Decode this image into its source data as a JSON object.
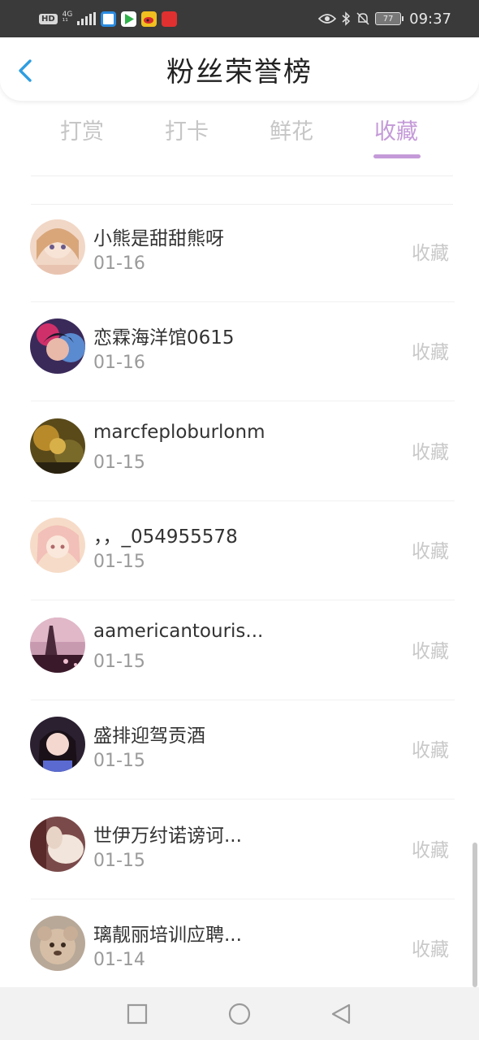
{
  "status_bar": {
    "left_badge": "HD",
    "network": "4G",
    "network_sub": "¹¹",
    "time": "09:37",
    "battery": "77",
    "icons": [
      "signal-icon",
      "app-blue-icon",
      "app-play-icon",
      "app-weibo-icon",
      "app-red-icon",
      "eye-icon",
      "bluetooth-icon",
      "mute-bell-icon",
      "battery-icon"
    ]
  },
  "header": {
    "title": "粉丝荣誉榜",
    "back_icon": "chevron-left-icon"
  },
  "tabs": [
    {
      "label": "打赏",
      "active": false
    },
    {
      "label": "打卡",
      "active": false
    },
    {
      "label": "鲜花",
      "active": false
    },
    {
      "label": "收藏",
      "active": true
    }
  ],
  "colors": {
    "accent": "#c49ad8",
    "inactive_tab": "#c6c6c6",
    "status_bar_bg": "#3a3a3a"
  },
  "list": [
    {
      "name": "小熊是甜甜熊呀",
      "date": "01-16",
      "action": "收藏"
    },
    {
      "name": "恋霖海洋馆0615",
      "date": "01-16",
      "action": "收藏"
    },
    {
      "name": "marcfeploburlonm",
      "date": "01-15",
      "action": "收藏"
    },
    {
      "name": "，，_054955578",
      "date": "01-15",
      "action": "收藏"
    },
    {
      "name": "aamericantouris...",
      "date": "01-15",
      "action": "收藏"
    },
    {
      "name": "盛排迎驾贡酒",
      "date": "01-15",
      "action": "收藏"
    },
    {
      "name": "世伊万纣诺谤诃...",
      "date": "01-15",
      "action": "收藏"
    },
    {
      "name": "璃靓丽培训应聘...",
      "date": "01-14",
      "action": "收藏"
    }
  ],
  "nav": {
    "icons": [
      "recent-apps-icon",
      "home-icon",
      "back-triangle-icon"
    ]
  }
}
